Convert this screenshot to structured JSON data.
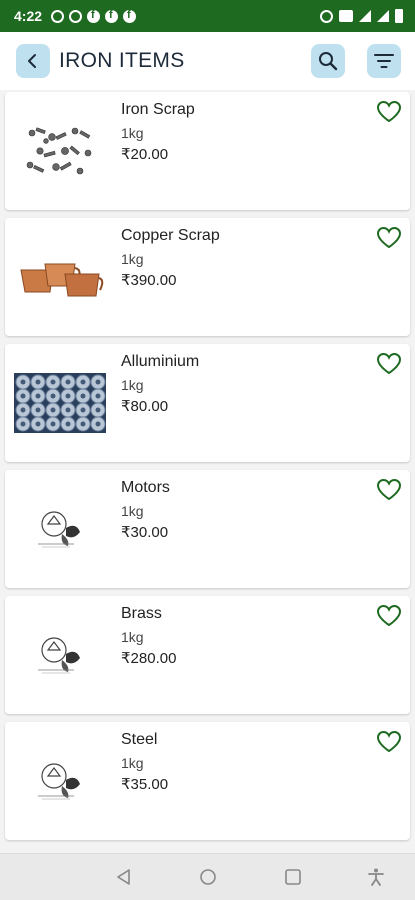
{
  "status_bar": {
    "time": "4:22",
    "left_icons": [
      "whatsapp-icon",
      "whatsapp-icon",
      "facebook-icon",
      "facebook-icon",
      "facebook-icon"
    ],
    "right_icons": [
      "alarm-icon",
      "volte-icon",
      "wifi-icon",
      "signal-icon",
      "battery-icon"
    ]
  },
  "header": {
    "back_icon": "chevron-left-icon",
    "title": "IRON ITEMS",
    "search_icon": "search-icon",
    "filter_icon": "filter-icon"
  },
  "products": [
    {
      "name": "Iron Scrap",
      "qty": "1kg",
      "price": "₹20.00",
      "image": "iron-scrap-image"
    },
    {
      "name": "Copper Scrap",
      "qty": "1kg",
      "price": "₹390.00",
      "image": "copper-scrap-image"
    },
    {
      "name": "Alluminium",
      "qty": "1kg",
      "price": "₹80.00",
      "image": "aluminium-image"
    },
    {
      "name": "Motors",
      "qty": "1kg",
      "price": "₹30.00",
      "image": "logo-placeholder-image"
    },
    {
      "name": "Brass",
      "qty": "1kg",
      "price": "₹280.00",
      "image": "logo-placeholder-image"
    },
    {
      "name": "Steel",
      "qty": "1kg",
      "price": "₹35.00",
      "image": "logo-placeholder-image"
    }
  ],
  "colors": {
    "status_bar": "#1e6a20",
    "accent_green": "#1e6a20",
    "icon_button_bg": "#bfe0ef"
  },
  "navbar": {
    "icons": [
      "back-triangle-icon",
      "home-circle-icon",
      "recents-square-icon",
      "accessibility-icon"
    ]
  }
}
